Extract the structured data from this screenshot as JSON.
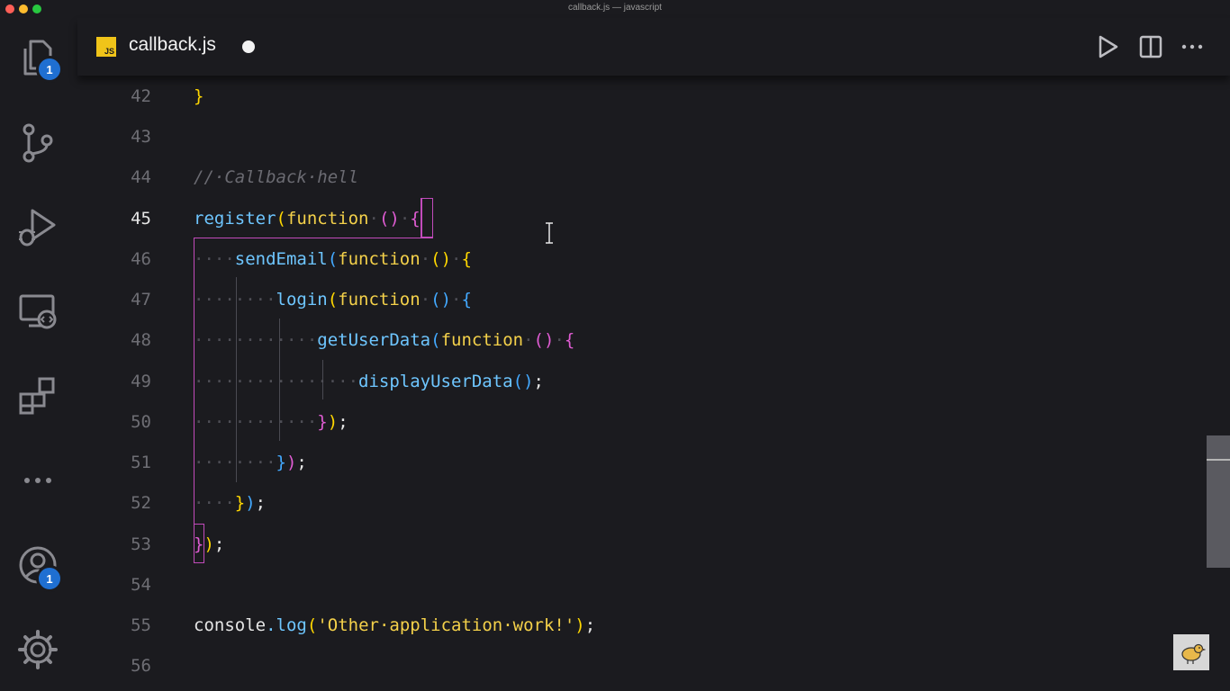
{
  "window": {
    "title": "callback.js — javascript"
  },
  "activity_bar": {
    "explorer_badge": "1",
    "accounts_badge": "1",
    "icons": [
      "files-icon",
      "source-control-icon",
      "run-debug-icon",
      "remote-explorer-icon",
      "extensions-icon",
      "more-icon",
      "accounts-icon",
      "settings-gear-icon"
    ]
  },
  "tab": {
    "language_badge": "JS",
    "filename": "callback.js",
    "unsaved": true
  },
  "toolbar": {
    "icons": [
      "run-icon",
      "split-editor-icon",
      "more-actions-icon"
    ]
  },
  "editor": {
    "active_line": 45,
    "line_numbers": [
      "42",
      "43",
      "44",
      "45",
      "46",
      "47",
      "48",
      "49",
      "50",
      "51",
      "52",
      "53",
      "54",
      "55",
      "56"
    ],
    "code": {
      "l42": {
        "brace": "}"
      },
      "l44": {
        "comment": "//·Callback·hell"
      },
      "l45": {
        "fn": "register",
        "open_paren": "(",
        "kw": "function",
        "sp1": "·",
        "parens": "()",
        "sp2": "·",
        "brace": "{"
      },
      "l46": {
        "indent": "····",
        "fn": "sendEmail",
        "open_paren": "(",
        "kw": "function",
        "sp1": "·",
        "parens": "()",
        "sp2": "·",
        "brace": "{"
      },
      "l47": {
        "indent": "········",
        "fn": "login",
        "open_paren": "(",
        "kw": "function",
        "sp1": "·",
        "parens": "()",
        "sp2": "·",
        "brace": "{"
      },
      "l48": {
        "indent": "············",
        "fn": "getUserData",
        "open_paren": "(",
        "kw": "function",
        "sp1": "·",
        "parens": "()",
        "sp2": "·",
        "brace": "{"
      },
      "l49": {
        "indent": "················",
        "fn": "displayUserData",
        "parens": "()",
        "semi": ";"
      },
      "l50": {
        "indent": "············",
        "brace": "}",
        "paren": ")",
        "semi": ";"
      },
      "l51": {
        "indent": "········",
        "brace": "}",
        "paren": ")",
        "semi": ";"
      },
      "l52": {
        "indent": "····",
        "brace": "}",
        "paren": ")",
        "semi": ";"
      },
      "l53": {
        "brace": "}",
        "paren": ")",
        "semi": ";"
      },
      "l55": {
        "obj": "console",
        "dot": ".",
        "fn": "log",
        "open_paren": "(",
        "str": "'Other·application·work!'",
        "close_paren": ")",
        "semi": ";"
      }
    }
  },
  "colors": {
    "function_name": "#6ec6ff",
    "keyword": "#f4d14a",
    "bracket_level1": "#ffd700",
    "bracket_level2": "#e05cd3",
    "bracket_level3": "#43a9ff",
    "comment": "#6b6b72",
    "badge": "#1f6fd1",
    "js_badge": "#f0c419"
  }
}
